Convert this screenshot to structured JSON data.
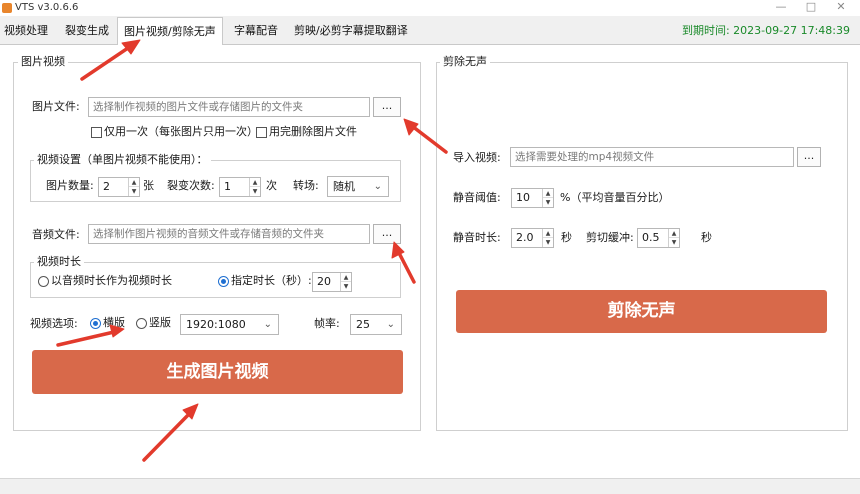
{
  "window": {
    "title": "VTS v3.0.6.6"
  },
  "tabs": [
    {
      "label": "视频处理"
    },
    {
      "label": "裂变生成"
    },
    {
      "label": "图片视频/剪除无声"
    },
    {
      "label": "字幕配音"
    },
    {
      "label": "剪映/必剪字幕提取翻译"
    }
  ],
  "expire": "到期时间: 2023-09-27 17:48:39",
  "colors": {
    "accent_button": "#d8694a",
    "expire_text": "#1a8a2a",
    "annotation_arrow": "#e23a2c"
  },
  "image_video": {
    "group_title": "图片视频",
    "image_file_label": "图片文件:",
    "image_file_placeholder": "选择制作视频的图片文件或存储图片的文件夹",
    "browse_label": "...",
    "use_once_label": "仅用一次（每张图片只用一次）",
    "delete_after_label": "用完删除图片文件",
    "settings_group_title": "视频设置（单图片视频不能使用）：",
    "image_count_label": "图片数量:",
    "image_count": "2",
    "image_count_unit": "张",
    "fission_count_label": "裂变次数:",
    "fission_count": "1",
    "fission_count_unit": "次",
    "transition_label": "转场:",
    "transition_value": "随机",
    "audio_file_label": "音频文件:",
    "audio_file_placeholder": "选择制作图片视频的音频文件或存储音频的文件夹",
    "duration_group_title": "视频时长",
    "use_audio_duration_label": "以音频时长作为视频时长",
    "fixed_duration_label": "指定时长（秒）:",
    "fixed_duration": "20",
    "options_label": "视频选项:",
    "landscape_label": "横版",
    "portrait_label": "竖版",
    "resolution": "1920:1080",
    "fps_label": "帧率:",
    "fps": "25",
    "generate_label": "生成图片视频"
  },
  "silence_cut": {
    "group_title": "剪除无声",
    "import_label": "导入视频:",
    "import_placeholder": "选择需要处理的mp4视频文件",
    "browse_label": "...",
    "threshold_label": "静音阈值:",
    "threshold": "10",
    "threshold_unit": "%（平均音量百分比）",
    "silence_duration_label": "静音时长:",
    "silence_duration": "2.0",
    "silence_duration_unit": "秒",
    "cut_buffer_label": "剪切缓冲:",
    "cut_buffer": "0.5",
    "cut_buffer_unit": "秒",
    "cut_label": "剪除无声"
  }
}
